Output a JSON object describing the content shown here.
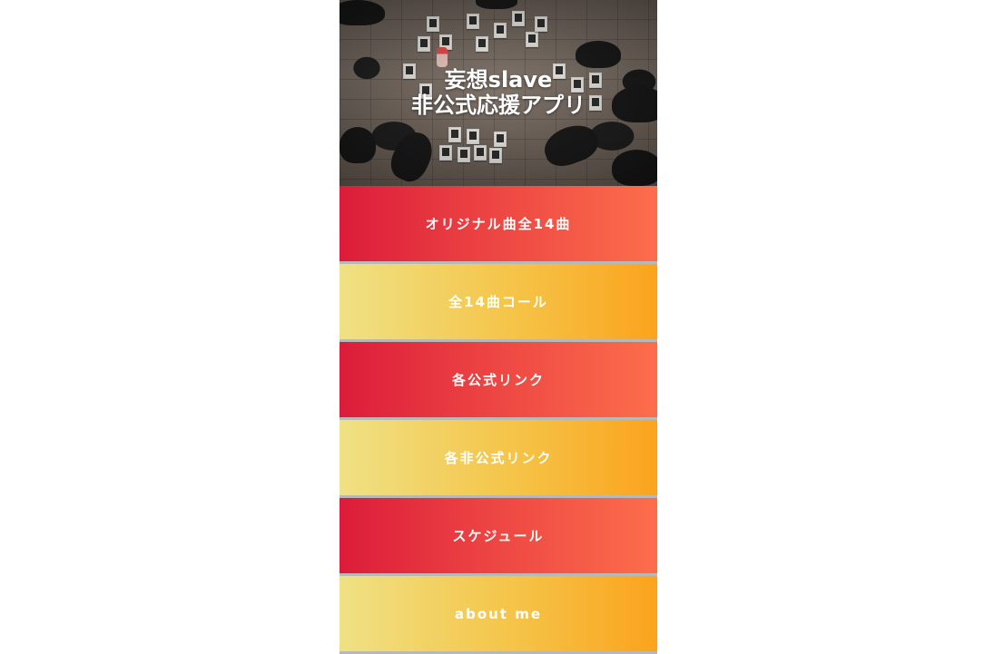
{
  "hero": {
    "title_line1": "妄想slave",
    "title_line2": "非公式応援アプリ"
  },
  "menu": {
    "items": [
      {
        "label": "オリジナル曲全14曲",
        "style": "red"
      },
      {
        "label": "全14曲コール",
        "style": "yellow"
      },
      {
        "label": "各公式リンク",
        "style": "red"
      },
      {
        "label": "各非公式リンク",
        "style": "yellow"
      },
      {
        "label": "スケジュール",
        "style": "red"
      },
      {
        "label": "about me",
        "style": "yellow"
      }
    ]
  },
  "colors": {
    "red_start": "#dc1c3a",
    "red_end": "#fc6e4b",
    "yellow_start": "#efe184",
    "yellow_end": "#fba31d",
    "divider": "#b8b8b8"
  }
}
